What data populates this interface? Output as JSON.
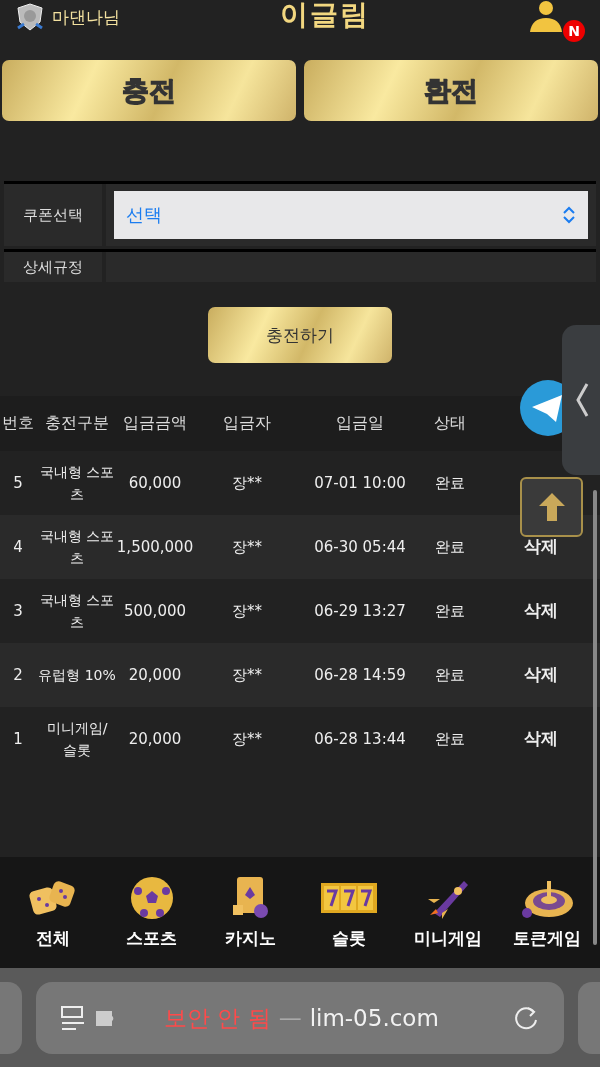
{
  "header": {
    "user_name": "마댄나님",
    "logo": "이글림",
    "notification_badge": "N"
  },
  "main_tabs": [
    {
      "label": "충전"
    },
    {
      "label": "환전"
    }
  ],
  "form": {
    "rows": [
      {
        "kind": "select",
        "label": "쿠폰선택",
        "value": "선택"
      },
      {
        "kind": "text",
        "label": "상세규정"
      }
    ]
  },
  "submit_button": "충전하기",
  "table": {
    "columns": [
      "번호",
      "충전구분",
      "입금금액",
      "입금자",
      "입금일",
      "상태"
    ],
    "rows": [
      {
        "no": "5",
        "type": "국내형 스포츠",
        "amount": "60,000",
        "depositor": "장**",
        "date": "07-01 10:00",
        "status": "완료"
      },
      {
        "no": "4",
        "type": "국내형 스포츠",
        "amount": "1,500,000",
        "depositor": "장**",
        "date": "06-30 05:44",
        "status": "완료",
        "action": "삭제"
      },
      {
        "no": "3",
        "type": "국내형 스포츠",
        "amount": "500,000",
        "depositor": "장**",
        "date": "06-29 13:27",
        "status": "완료",
        "action": "삭제"
      },
      {
        "no": "2",
        "type": "유럽형 10%",
        "amount": "20,000",
        "depositor": "장**",
        "date": "06-28 14:59",
        "status": "완료",
        "action": "삭제"
      },
      {
        "no": "1",
        "type": "미니게임/ 슬롯",
        "amount": "20,000",
        "depositor": "장**",
        "date": "06-28 13:44",
        "status": "완료",
        "action": "삭제"
      }
    ]
  },
  "bottom_nav": [
    {
      "kind": "dice",
      "label": "전체"
    },
    {
      "kind": "ball",
      "label": "스포츠"
    },
    {
      "kind": "cards",
      "label": "카지노"
    },
    {
      "kind": "slot",
      "label": "슬롯"
    },
    {
      "kind": "rocket",
      "label": "미니게임"
    },
    {
      "kind": "roulette",
      "label": "토큰게임"
    }
  ],
  "browser_bar": {
    "security": "보안 안 됨",
    "separator": "—",
    "url": "lim-05.com"
  }
}
